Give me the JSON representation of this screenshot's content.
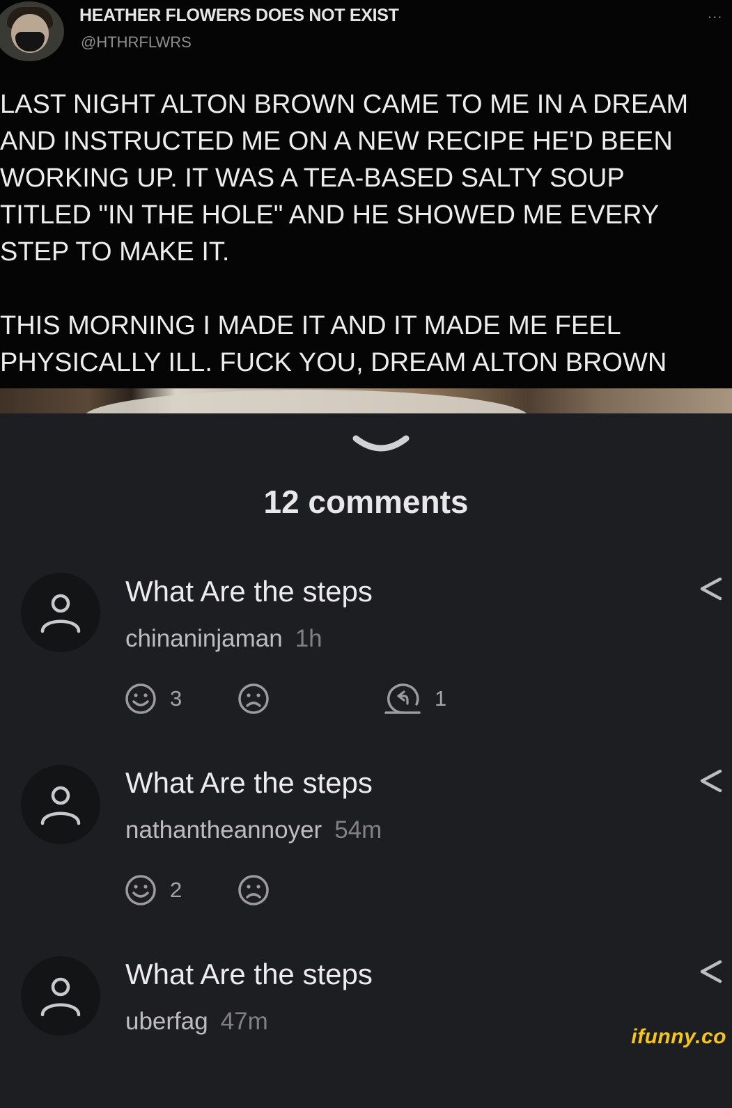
{
  "tweet": {
    "author_name": "HEATHER FLOWERS DOES NOT EXIST",
    "handle": "@HTHRFLWRS",
    "more": "...",
    "paragraph_1_lines": [
      "LAST NIGHT ALTON BROWN CAME TO ME IN A DREAM",
      "AND INSTRUCTED ME ON A NEW RECIPE HE'D BEEN",
      "WORKING UP. IT WAS A TEA-BASED SALTY SOUP",
      "TITLED \"IN THE HOLE\" AND HE SHOWED ME EVERY",
      "STEP TO MAKE IT."
    ],
    "paragraph_2_lines": [
      "THIS MORNING I MADE IT AND IT MADE ME FEEL",
      "PHYSICALLY ILL. FUCK YOU, DREAM ALTON BROWN"
    ]
  },
  "comments_header": "12 comments",
  "comments": [
    {
      "text": "What Are the steps",
      "user": "chinaninjaman",
      "time": "1h",
      "likes": "3",
      "replies": "1"
    },
    {
      "text": "What Are the steps",
      "user": "nathantheannoyer",
      "time": "54m",
      "likes": "2",
      "replies": null
    },
    {
      "text": "What Are the steps",
      "user": "uberfag",
      "time": "47m",
      "likes": null,
      "replies": null
    }
  ],
  "watermark": "ifunny.co",
  "colors": {
    "panel_bg": "#1d1e22",
    "tweet_bg": "#050505",
    "avatar_bg": "#131416",
    "icon_gray": "#9b9ba0",
    "watermark": "#f5c518"
  },
  "icons": [
    "collapse-chevron-icon",
    "user-icon",
    "share-icon",
    "smile-icon",
    "sad-icon",
    "reply-icon"
  ]
}
